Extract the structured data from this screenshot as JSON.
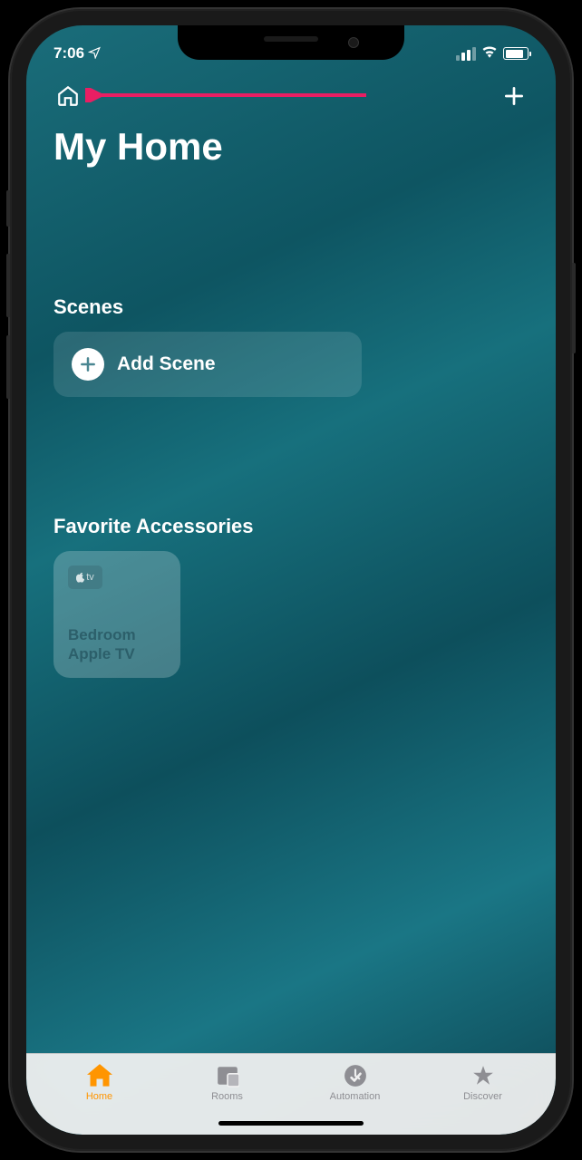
{
  "status_bar": {
    "time": "7:06",
    "location_active": true
  },
  "nav": {
    "page_title": "My Home"
  },
  "sections": {
    "scenes_header": "Scenes",
    "add_scene_label": "Add Scene",
    "favorites_header": "Favorite Accessories"
  },
  "accessories": [
    {
      "badge": "tv",
      "name_line1": "Bedroom",
      "name_line2": "Apple TV"
    }
  ],
  "tabs": [
    {
      "label": "Home",
      "active": true
    },
    {
      "label": "Rooms",
      "active": false
    },
    {
      "label": "Automation",
      "active": false
    },
    {
      "label": "Discover",
      "active": false
    }
  ],
  "colors": {
    "accent_active": "#ff9500",
    "inactive": "#8e8e93"
  },
  "annotation": {
    "arrow_color": "#e91e63"
  }
}
